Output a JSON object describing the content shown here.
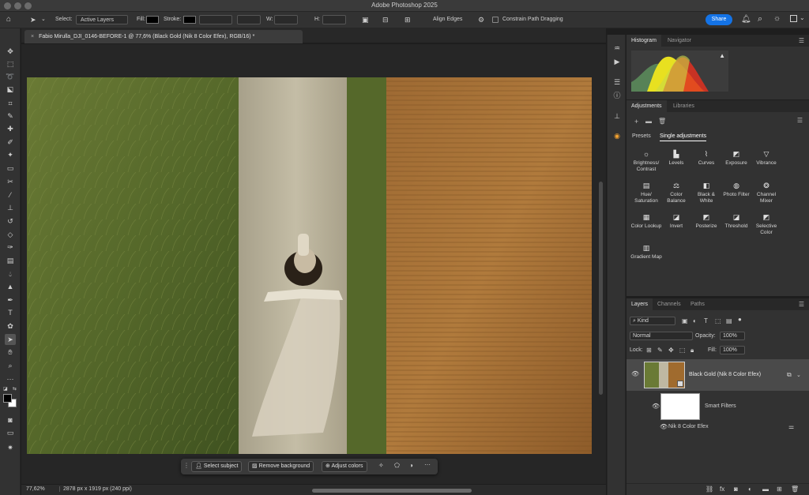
{
  "app": {
    "title": "Adobe Photoshop 2025"
  },
  "options_bar": {
    "select_label": "Select:",
    "select_value": "Active Layers",
    "fill_label": "Fill:",
    "stroke_label": "Stroke:",
    "w_label": "W:",
    "h_label": "H:",
    "align_edges_label": "Align Edges",
    "constrain_label": "Constrain Path Dragging",
    "share_label": "Share"
  },
  "document": {
    "tab_title": "Fabio Mirulla_DJI_0146-BEFORE-1 @ 77,6% (Black Gold (Nik 8 Color Efex), RGB/16) *",
    "close_glyph": "×"
  },
  "status": {
    "zoom": "77,62%",
    "dimensions": "2878 px x 1919 px (240 ppi)"
  },
  "context_bar": {
    "select_subject": "Select subject",
    "remove_background": "Remove background",
    "adjust_colors": "Adjust colors"
  },
  "panels": {
    "histogram_tab": "Histogram",
    "navigator_tab": "Navigator",
    "adjustments_tab": "Adjustments",
    "libraries_tab": "Libraries",
    "presets_tab": "Presets",
    "single_adjustments_tab": "Single adjustments",
    "adjustments": [
      {
        "label": "Brightness/ Contrast",
        "icon": "sun-icon"
      },
      {
        "label": "Levels",
        "icon": "levels-icon"
      },
      {
        "label": "Curves",
        "icon": "curves-icon"
      },
      {
        "label": "Exposure",
        "icon": "exposure-icon"
      },
      {
        "label": "Vibrance",
        "icon": "vibrance-icon"
      },
      {
        "label": "Hue/ Saturation",
        "icon": "hue-icon"
      },
      {
        "label": "Color Balance",
        "icon": "balance-icon"
      },
      {
        "label": "Black & White",
        "icon": "bw-icon"
      },
      {
        "label": "Photo Filter",
        "icon": "camera-icon"
      },
      {
        "label": "Channel Mixer",
        "icon": "mixer-icon"
      },
      {
        "label": "Color Lookup",
        "icon": "grid-icon"
      },
      {
        "label": "Invert",
        "icon": "invert-icon"
      },
      {
        "label": "Posterize",
        "icon": "posterize-icon"
      },
      {
        "label": "Threshold",
        "icon": "threshold-icon"
      },
      {
        "label": "Selective Color",
        "icon": "selective-icon"
      },
      {
        "label": "Gradient Map",
        "icon": "gradient-icon"
      }
    ],
    "layers_tab": "Layers",
    "channels_tab": "Channels",
    "paths_tab": "Paths",
    "kind_label": "Kind",
    "blend_mode": "Normal",
    "opacity_label": "Opacity:",
    "opacity_value": "100%",
    "lock_label": "Lock:",
    "fill_label": "Fill:",
    "fill_value": "100%",
    "layer_name": "Black Gold (Nik 8 Color Efex)",
    "smart_filters_label": "Smart Filters",
    "filter_name": "Nik 8 Color Efex"
  },
  "colors": {
    "accent": "#1473e6",
    "grass": "#5d6e2b",
    "path": "#bfb8a2",
    "soil": "#a06b2e"
  }
}
